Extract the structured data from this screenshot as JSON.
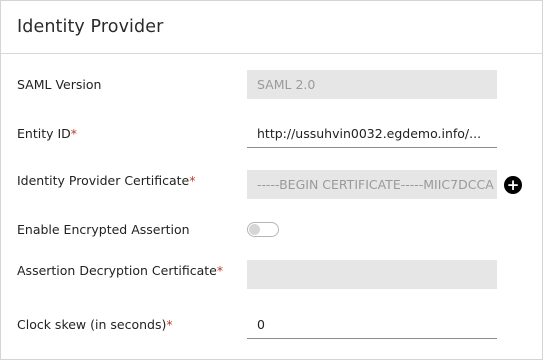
{
  "header": {
    "title": "Identity Provider"
  },
  "form": {
    "saml_version": {
      "label": "SAML Version",
      "value": "SAML 2.0"
    },
    "entity_id": {
      "label": "Entity ID",
      "required": "*",
      "value": "http://ussuhvin0032.egdemo.info/..."
    },
    "idp_certificate": {
      "label": "Identity Provider Certificate",
      "required": "*",
      "value": "-----BEGIN CERTIFICATE-----MIIC7DCCA",
      "add_icon": "plus-circle-icon"
    },
    "encrypted_assertion": {
      "label": "Enable Encrypted Assertion",
      "enabled": false
    },
    "decryption_certificate": {
      "label": "Assertion Decryption Certificate",
      "required": "*",
      "value": ""
    },
    "clock_skew": {
      "label": "Clock skew (in seconds)",
      "required": "*",
      "value": "0"
    }
  }
}
